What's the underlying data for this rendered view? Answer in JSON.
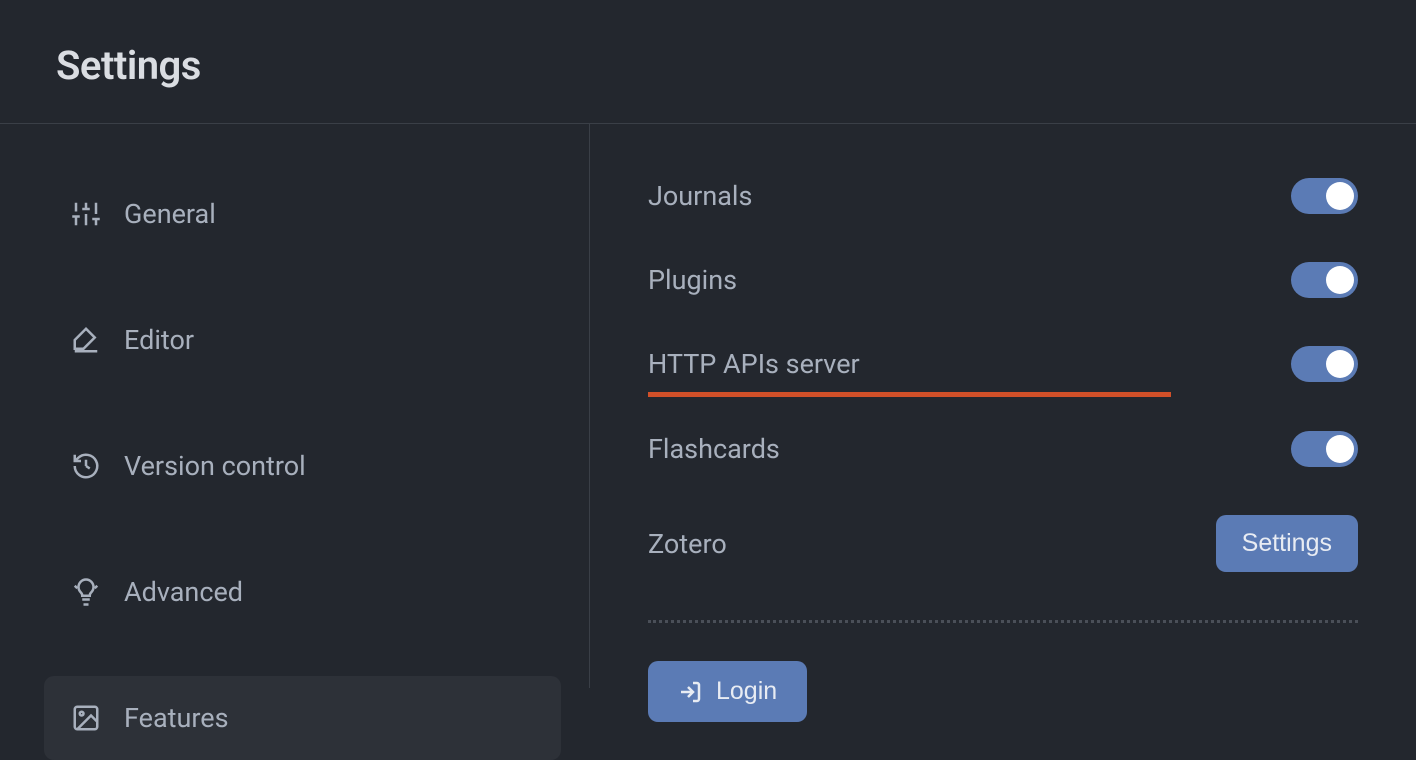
{
  "header": {
    "title": "Settings"
  },
  "sidebar": {
    "items": [
      {
        "label": "General",
        "icon": "sliders-icon",
        "active": false
      },
      {
        "label": "Editor",
        "icon": "pen-icon",
        "active": false
      },
      {
        "label": "Version control",
        "icon": "history-icon",
        "active": false
      },
      {
        "label": "Advanced",
        "icon": "lightbulb-icon",
        "active": false
      },
      {
        "label": "Features",
        "icon": "image-icon",
        "active": true
      }
    ]
  },
  "main": {
    "features": [
      {
        "label": "Journals",
        "enabled": true
      },
      {
        "label": "Plugins",
        "enabled": true
      },
      {
        "label": "HTTP APIs server",
        "enabled": true,
        "highlighted": true
      },
      {
        "label": "Flashcards",
        "enabled": true
      },
      {
        "label": "Zotero",
        "action": "Settings"
      }
    ],
    "login_label": "Login"
  },
  "colors": {
    "background": "#23272e",
    "accent": "#5b7bb5",
    "highlight": "#d15029"
  }
}
